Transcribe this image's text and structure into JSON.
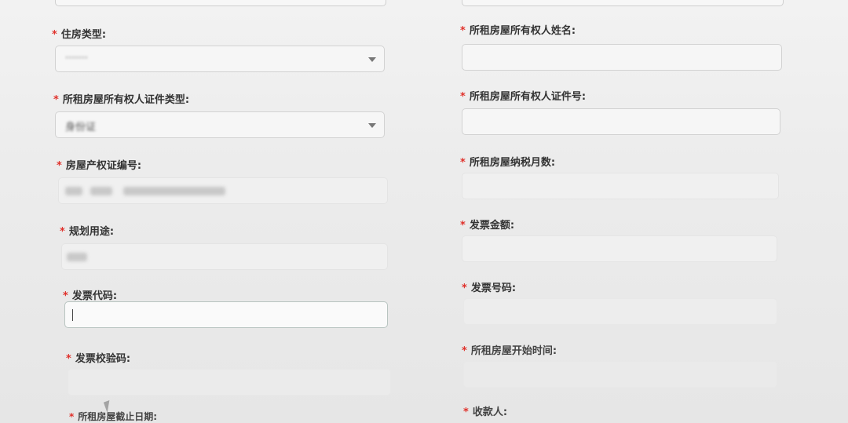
{
  "form": {
    "left": [
      {
        "label": "住房类型:",
        "value": "·······",
        "type": "select"
      },
      {
        "label": "所租房屋所有权人证件类型:",
        "value": "身份证",
        "type": "select"
      },
      {
        "label": "房屋产权证编号:",
        "value": "",
        "type": "input-redacted"
      },
      {
        "label": "规划用途:",
        "value": "",
        "type": "input-redacted"
      },
      {
        "label": "发票代码:",
        "value": "",
        "type": "input-focused"
      },
      {
        "label": "发票校验码:",
        "value": "",
        "type": "input"
      },
      {
        "label": "所租房屋截止日期:",
        "value": "",
        "type": "input"
      }
    ],
    "right": [
      {
        "label": "所租房屋所有权人姓名:",
        "value": "",
        "type": "input"
      },
      {
        "label": "所租房屋所有权人证件号:",
        "value": "",
        "type": "input"
      },
      {
        "label": "所租房屋纳税月数:",
        "value": "",
        "type": "input"
      },
      {
        "label": "发票金额:",
        "value": "",
        "type": "input"
      },
      {
        "label": "发票号码:",
        "value": "",
        "type": "input"
      },
      {
        "label": "所租房屋开始时间:",
        "value": "",
        "type": "input"
      },
      {
        "label": "收款人:",
        "value": "",
        "type": "input"
      }
    ]
  },
  "colors": {
    "required_star": "#e0302a",
    "label": "#333333",
    "border": "#d2d2d2"
  }
}
